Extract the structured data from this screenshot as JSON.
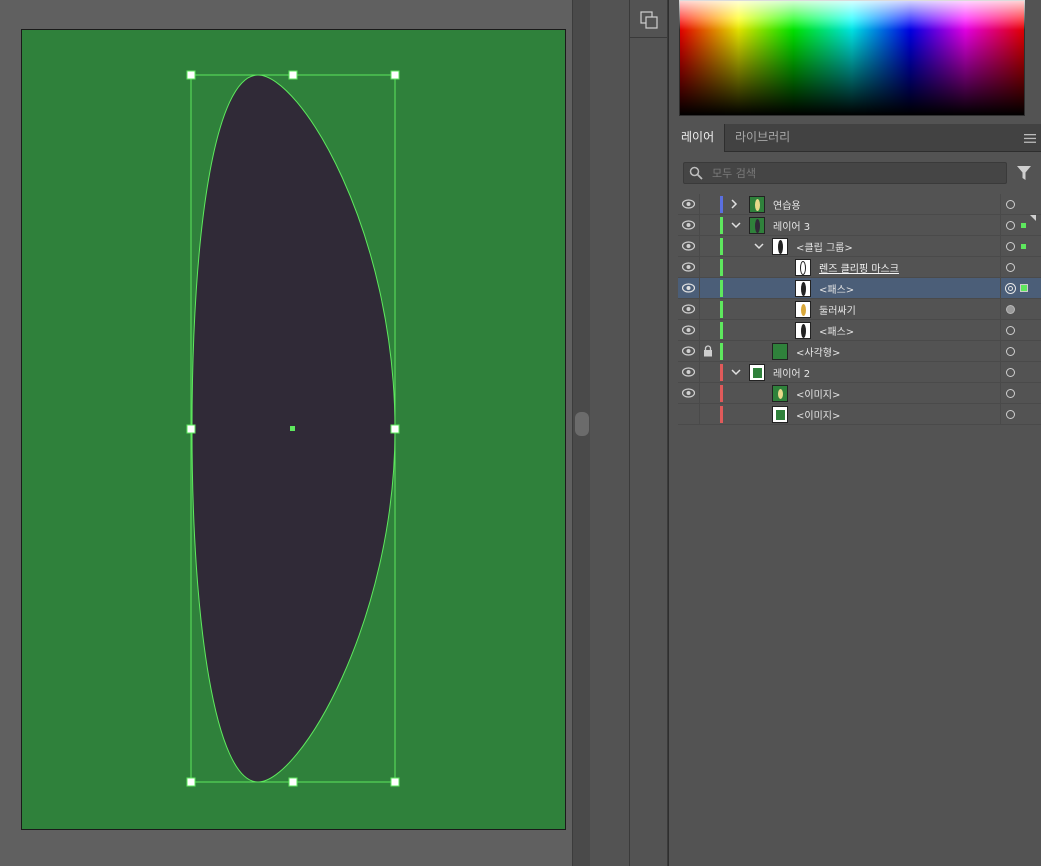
{
  "panel": {
    "tabs": [
      {
        "label": "레이어"
      },
      {
        "label": "라이브러리"
      }
    ],
    "search": {
      "placeholder": "모두 검색",
      "value": ""
    }
  },
  "layers": [
    {
      "label": "연습용",
      "color": "#5a6fe0",
      "expanded": false,
      "visible": true,
      "locked": false
    },
    {
      "label": "레이어 3",
      "color": "#5ee85e",
      "expanded": true,
      "visible": true,
      "locked": false
    },
    {
      "label": "<클립 그룹>",
      "color": "#5ee85e",
      "expanded": true,
      "visible": true,
      "locked": false
    },
    {
      "label": "렌즈 클리핑 마스크",
      "color": "#5ee85e",
      "visible": true,
      "locked": false,
      "underline": true
    },
    {
      "label": "<패스>",
      "color": "#5ee85e",
      "visible": true,
      "locked": false,
      "selected": true
    },
    {
      "label": "둘러싸기",
      "color": "#5ee85e",
      "visible": true,
      "locked": false
    },
    {
      "label": "<패스>",
      "color": "#5ee85e",
      "visible": true,
      "locked": false
    },
    {
      "label": "<사각형>",
      "color": "#5ee85e",
      "visible": true,
      "locked": true
    },
    {
      "label": "레이어 2",
      "color": "#e05a5a",
      "expanded": true,
      "visible": true,
      "locked": false
    },
    {
      "label": "<이미지>",
      "color": "#e05a5a",
      "visible": true,
      "locked": false
    },
    {
      "label": "<이미지>",
      "color": "#e05a5a",
      "visible": false,
      "locked": false
    }
  ],
  "colors": {
    "artboard": "#2f813b",
    "ellipse_fill": "#302a37",
    "selection": "#5ee85e",
    "panel_bg": "#535353",
    "selected_row": "#4b5e78"
  },
  "icons": [
    "pathfinder-icon",
    "panel-menu-icon",
    "search-icon",
    "filter-icon",
    "eye-icon",
    "lock-icon",
    "chevron-right-icon",
    "chevron-down-icon"
  ]
}
